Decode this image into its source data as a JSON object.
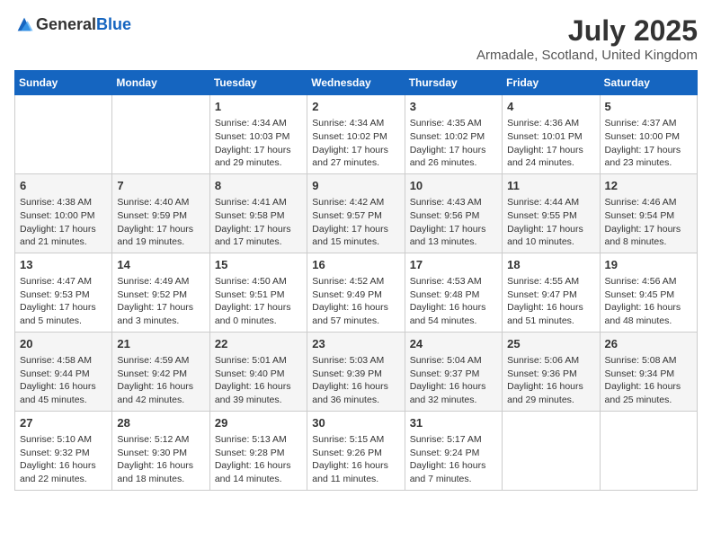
{
  "header": {
    "logo_general": "General",
    "logo_blue": "Blue",
    "month_title": "July 2025",
    "location": "Armadale, Scotland, United Kingdom"
  },
  "days_of_week": [
    "Sunday",
    "Monday",
    "Tuesday",
    "Wednesday",
    "Thursday",
    "Friday",
    "Saturday"
  ],
  "weeks": [
    [
      {
        "day": "",
        "info": ""
      },
      {
        "day": "",
        "info": ""
      },
      {
        "day": "1",
        "sunrise": "4:34 AM",
        "sunset": "10:03 PM",
        "daylight": "17 hours and 29 minutes."
      },
      {
        "day": "2",
        "sunrise": "4:34 AM",
        "sunset": "10:02 PM",
        "daylight": "17 hours and 27 minutes."
      },
      {
        "day": "3",
        "sunrise": "4:35 AM",
        "sunset": "10:02 PM",
        "daylight": "17 hours and 26 minutes."
      },
      {
        "day": "4",
        "sunrise": "4:36 AM",
        "sunset": "10:01 PM",
        "daylight": "17 hours and 24 minutes."
      },
      {
        "day": "5",
        "sunrise": "4:37 AM",
        "sunset": "10:00 PM",
        "daylight": "17 hours and 23 minutes."
      }
    ],
    [
      {
        "day": "6",
        "sunrise": "4:38 AM",
        "sunset": "10:00 PM",
        "daylight": "17 hours and 21 minutes."
      },
      {
        "day": "7",
        "sunrise": "4:40 AM",
        "sunset": "9:59 PM",
        "daylight": "17 hours and 19 minutes."
      },
      {
        "day": "8",
        "sunrise": "4:41 AM",
        "sunset": "9:58 PM",
        "daylight": "17 hours and 17 minutes."
      },
      {
        "day": "9",
        "sunrise": "4:42 AM",
        "sunset": "9:57 PM",
        "daylight": "17 hours and 15 minutes."
      },
      {
        "day": "10",
        "sunrise": "4:43 AM",
        "sunset": "9:56 PM",
        "daylight": "17 hours and 13 minutes."
      },
      {
        "day": "11",
        "sunrise": "4:44 AM",
        "sunset": "9:55 PM",
        "daylight": "17 hours and 10 minutes."
      },
      {
        "day": "12",
        "sunrise": "4:46 AM",
        "sunset": "9:54 PM",
        "daylight": "17 hours and 8 minutes."
      }
    ],
    [
      {
        "day": "13",
        "sunrise": "4:47 AM",
        "sunset": "9:53 PM",
        "daylight": "17 hours and 5 minutes."
      },
      {
        "day": "14",
        "sunrise": "4:49 AM",
        "sunset": "9:52 PM",
        "daylight": "17 hours and 3 minutes."
      },
      {
        "day": "15",
        "sunrise": "4:50 AM",
        "sunset": "9:51 PM",
        "daylight": "17 hours and 0 minutes."
      },
      {
        "day": "16",
        "sunrise": "4:52 AM",
        "sunset": "9:49 PM",
        "daylight": "16 hours and 57 minutes."
      },
      {
        "day": "17",
        "sunrise": "4:53 AM",
        "sunset": "9:48 PM",
        "daylight": "16 hours and 54 minutes."
      },
      {
        "day": "18",
        "sunrise": "4:55 AM",
        "sunset": "9:47 PM",
        "daylight": "16 hours and 51 minutes."
      },
      {
        "day": "19",
        "sunrise": "4:56 AM",
        "sunset": "9:45 PM",
        "daylight": "16 hours and 48 minutes."
      }
    ],
    [
      {
        "day": "20",
        "sunrise": "4:58 AM",
        "sunset": "9:44 PM",
        "daylight": "16 hours and 45 minutes."
      },
      {
        "day": "21",
        "sunrise": "4:59 AM",
        "sunset": "9:42 PM",
        "daylight": "16 hours and 42 minutes."
      },
      {
        "day": "22",
        "sunrise": "5:01 AM",
        "sunset": "9:40 PM",
        "daylight": "16 hours and 39 minutes."
      },
      {
        "day": "23",
        "sunrise": "5:03 AM",
        "sunset": "9:39 PM",
        "daylight": "16 hours and 36 minutes."
      },
      {
        "day": "24",
        "sunrise": "5:04 AM",
        "sunset": "9:37 PM",
        "daylight": "16 hours and 32 minutes."
      },
      {
        "day": "25",
        "sunrise": "5:06 AM",
        "sunset": "9:36 PM",
        "daylight": "16 hours and 29 minutes."
      },
      {
        "day": "26",
        "sunrise": "5:08 AM",
        "sunset": "9:34 PM",
        "daylight": "16 hours and 25 minutes."
      }
    ],
    [
      {
        "day": "27",
        "sunrise": "5:10 AM",
        "sunset": "9:32 PM",
        "daylight": "16 hours and 22 minutes."
      },
      {
        "day": "28",
        "sunrise": "5:12 AM",
        "sunset": "9:30 PM",
        "daylight": "16 hours and 18 minutes."
      },
      {
        "day": "29",
        "sunrise": "5:13 AM",
        "sunset": "9:28 PM",
        "daylight": "16 hours and 14 minutes."
      },
      {
        "day": "30",
        "sunrise": "5:15 AM",
        "sunset": "9:26 PM",
        "daylight": "16 hours and 11 minutes."
      },
      {
        "day": "31",
        "sunrise": "5:17 AM",
        "sunset": "9:24 PM",
        "daylight": "16 hours and 7 minutes."
      },
      {
        "day": "",
        "info": ""
      },
      {
        "day": "",
        "info": ""
      }
    ]
  ],
  "labels": {
    "sunrise": "Sunrise:",
    "sunset": "Sunset:",
    "daylight": "Daylight:"
  }
}
